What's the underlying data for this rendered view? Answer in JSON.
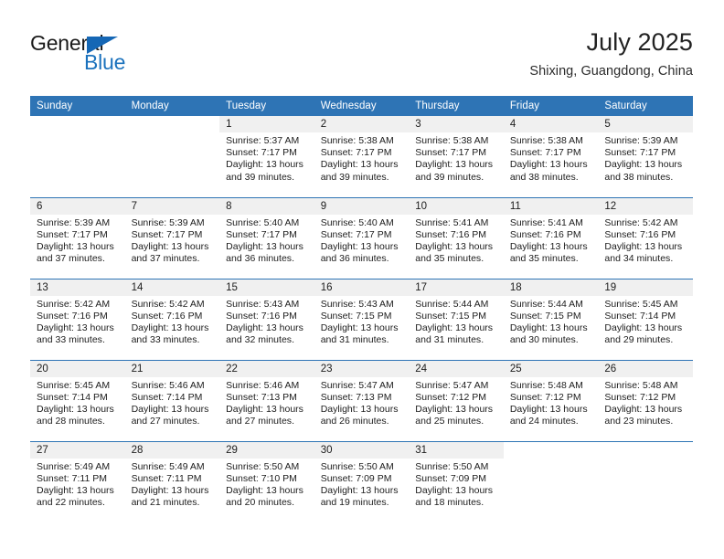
{
  "brand": {
    "name_top": "General",
    "name_bottom": "Blue",
    "triangle_color": "#1567b5",
    "text_color": "#1b72bd"
  },
  "header": {
    "title": "July 2025",
    "subtitle": "Shixing, Guangdong, China"
  },
  "theme": {
    "header_bg": "#2e74b5",
    "header_text": "#ffffff",
    "daynum_bg": "#f0f0f0",
    "rule_color": "#2e74b5",
    "body_text": "#1c1c1c"
  },
  "weekdays": [
    "Sunday",
    "Monday",
    "Tuesday",
    "Wednesday",
    "Thursday",
    "Friday",
    "Saturday"
  ],
  "labels": {
    "sunrise_prefix": "Sunrise:",
    "sunset_prefix": "Sunset:",
    "daylight_prefix": "Daylight:"
  },
  "weeks": [
    [
      {
        "day": ""
      },
      {
        "day": ""
      },
      {
        "day": "1",
        "sunrise": "Sunrise: 5:37 AM",
        "sunset": "Sunset: 7:17 PM",
        "daylight_1": "Daylight: 13 hours",
        "daylight_2": "and 39 minutes."
      },
      {
        "day": "2",
        "sunrise": "Sunrise: 5:38 AM",
        "sunset": "Sunset: 7:17 PM",
        "daylight_1": "Daylight: 13 hours",
        "daylight_2": "and 39 minutes."
      },
      {
        "day": "3",
        "sunrise": "Sunrise: 5:38 AM",
        "sunset": "Sunset: 7:17 PM",
        "daylight_1": "Daylight: 13 hours",
        "daylight_2": "and 39 minutes."
      },
      {
        "day": "4",
        "sunrise": "Sunrise: 5:38 AM",
        "sunset": "Sunset: 7:17 PM",
        "daylight_1": "Daylight: 13 hours",
        "daylight_2": "and 38 minutes."
      },
      {
        "day": "5",
        "sunrise": "Sunrise: 5:39 AM",
        "sunset": "Sunset: 7:17 PM",
        "daylight_1": "Daylight: 13 hours",
        "daylight_2": "and 38 minutes."
      }
    ],
    [
      {
        "day": "6",
        "sunrise": "Sunrise: 5:39 AM",
        "sunset": "Sunset: 7:17 PM",
        "daylight_1": "Daylight: 13 hours",
        "daylight_2": "and 37 minutes."
      },
      {
        "day": "7",
        "sunrise": "Sunrise: 5:39 AM",
        "sunset": "Sunset: 7:17 PM",
        "daylight_1": "Daylight: 13 hours",
        "daylight_2": "and 37 minutes."
      },
      {
        "day": "8",
        "sunrise": "Sunrise: 5:40 AM",
        "sunset": "Sunset: 7:17 PM",
        "daylight_1": "Daylight: 13 hours",
        "daylight_2": "and 36 minutes."
      },
      {
        "day": "9",
        "sunrise": "Sunrise: 5:40 AM",
        "sunset": "Sunset: 7:17 PM",
        "daylight_1": "Daylight: 13 hours",
        "daylight_2": "and 36 minutes."
      },
      {
        "day": "10",
        "sunrise": "Sunrise: 5:41 AM",
        "sunset": "Sunset: 7:16 PM",
        "daylight_1": "Daylight: 13 hours",
        "daylight_2": "and 35 minutes."
      },
      {
        "day": "11",
        "sunrise": "Sunrise: 5:41 AM",
        "sunset": "Sunset: 7:16 PM",
        "daylight_1": "Daylight: 13 hours",
        "daylight_2": "and 35 minutes."
      },
      {
        "day": "12",
        "sunrise": "Sunrise: 5:42 AM",
        "sunset": "Sunset: 7:16 PM",
        "daylight_1": "Daylight: 13 hours",
        "daylight_2": "and 34 minutes."
      }
    ],
    [
      {
        "day": "13",
        "sunrise": "Sunrise: 5:42 AM",
        "sunset": "Sunset: 7:16 PM",
        "daylight_1": "Daylight: 13 hours",
        "daylight_2": "and 33 minutes."
      },
      {
        "day": "14",
        "sunrise": "Sunrise: 5:42 AM",
        "sunset": "Sunset: 7:16 PM",
        "daylight_1": "Daylight: 13 hours",
        "daylight_2": "and 33 minutes."
      },
      {
        "day": "15",
        "sunrise": "Sunrise: 5:43 AM",
        "sunset": "Sunset: 7:16 PM",
        "daylight_1": "Daylight: 13 hours",
        "daylight_2": "and 32 minutes."
      },
      {
        "day": "16",
        "sunrise": "Sunrise: 5:43 AM",
        "sunset": "Sunset: 7:15 PM",
        "daylight_1": "Daylight: 13 hours",
        "daylight_2": "and 31 minutes."
      },
      {
        "day": "17",
        "sunrise": "Sunrise: 5:44 AM",
        "sunset": "Sunset: 7:15 PM",
        "daylight_1": "Daylight: 13 hours",
        "daylight_2": "and 31 minutes."
      },
      {
        "day": "18",
        "sunrise": "Sunrise: 5:44 AM",
        "sunset": "Sunset: 7:15 PM",
        "daylight_1": "Daylight: 13 hours",
        "daylight_2": "and 30 minutes."
      },
      {
        "day": "19",
        "sunrise": "Sunrise: 5:45 AM",
        "sunset": "Sunset: 7:14 PM",
        "daylight_1": "Daylight: 13 hours",
        "daylight_2": "and 29 minutes."
      }
    ],
    [
      {
        "day": "20",
        "sunrise": "Sunrise: 5:45 AM",
        "sunset": "Sunset: 7:14 PM",
        "daylight_1": "Daylight: 13 hours",
        "daylight_2": "and 28 minutes."
      },
      {
        "day": "21",
        "sunrise": "Sunrise: 5:46 AM",
        "sunset": "Sunset: 7:14 PM",
        "daylight_1": "Daylight: 13 hours",
        "daylight_2": "and 27 minutes."
      },
      {
        "day": "22",
        "sunrise": "Sunrise: 5:46 AM",
        "sunset": "Sunset: 7:13 PM",
        "daylight_1": "Daylight: 13 hours",
        "daylight_2": "and 27 minutes."
      },
      {
        "day": "23",
        "sunrise": "Sunrise: 5:47 AM",
        "sunset": "Sunset: 7:13 PM",
        "daylight_1": "Daylight: 13 hours",
        "daylight_2": "and 26 minutes."
      },
      {
        "day": "24",
        "sunrise": "Sunrise: 5:47 AM",
        "sunset": "Sunset: 7:12 PM",
        "daylight_1": "Daylight: 13 hours",
        "daylight_2": "and 25 minutes."
      },
      {
        "day": "25",
        "sunrise": "Sunrise: 5:48 AM",
        "sunset": "Sunset: 7:12 PM",
        "daylight_1": "Daylight: 13 hours",
        "daylight_2": "and 24 minutes."
      },
      {
        "day": "26",
        "sunrise": "Sunrise: 5:48 AM",
        "sunset": "Sunset: 7:12 PM",
        "daylight_1": "Daylight: 13 hours",
        "daylight_2": "and 23 minutes."
      }
    ],
    [
      {
        "day": "27",
        "sunrise": "Sunrise: 5:49 AM",
        "sunset": "Sunset: 7:11 PM",
        "daylight_1": "Daylight: 13 hours",
        "daylight_2": "and 22 minutes."
      },
      {
        "day": "28",
        "sunrise": "Sunrise: 5:49 AM",
        "sunset": "Sunset: 7:11 PM",
        "daylight_1": "Daylight: 13 hours",
        "daylight_2": "and 21 minutes."
      },
      {
        "day": "29",
        "sunrise": "Sunrise: 5:50 AM",
        "sunset": "Sunset: 7:10 PM",
        "daylight_1": "Daylight: 13 hours",
        "daylight_2": "and 20 minutes."
      },
      {
        "day": "30",
        "sunrise": "Sunrise: 5:50 AM",
        "sunset": "Sunset: 7:09 PM",
        "daylight_1": "Daylight: 13 hours",
        "daylight_2": "and 19 minutes."
      },
      {
        "day": "31",
        "sunrise": "Sunrise: 5:50 AM",
        "sunset": "Sunset: 7:09 PM",
        "daylight_1": "Daylight: 13 hours",
        "daylight_2": "and 18 minutes."
      },
      {
        "day": ""
      },
      {
        "day": ""
      }
    ]
  ]
}
